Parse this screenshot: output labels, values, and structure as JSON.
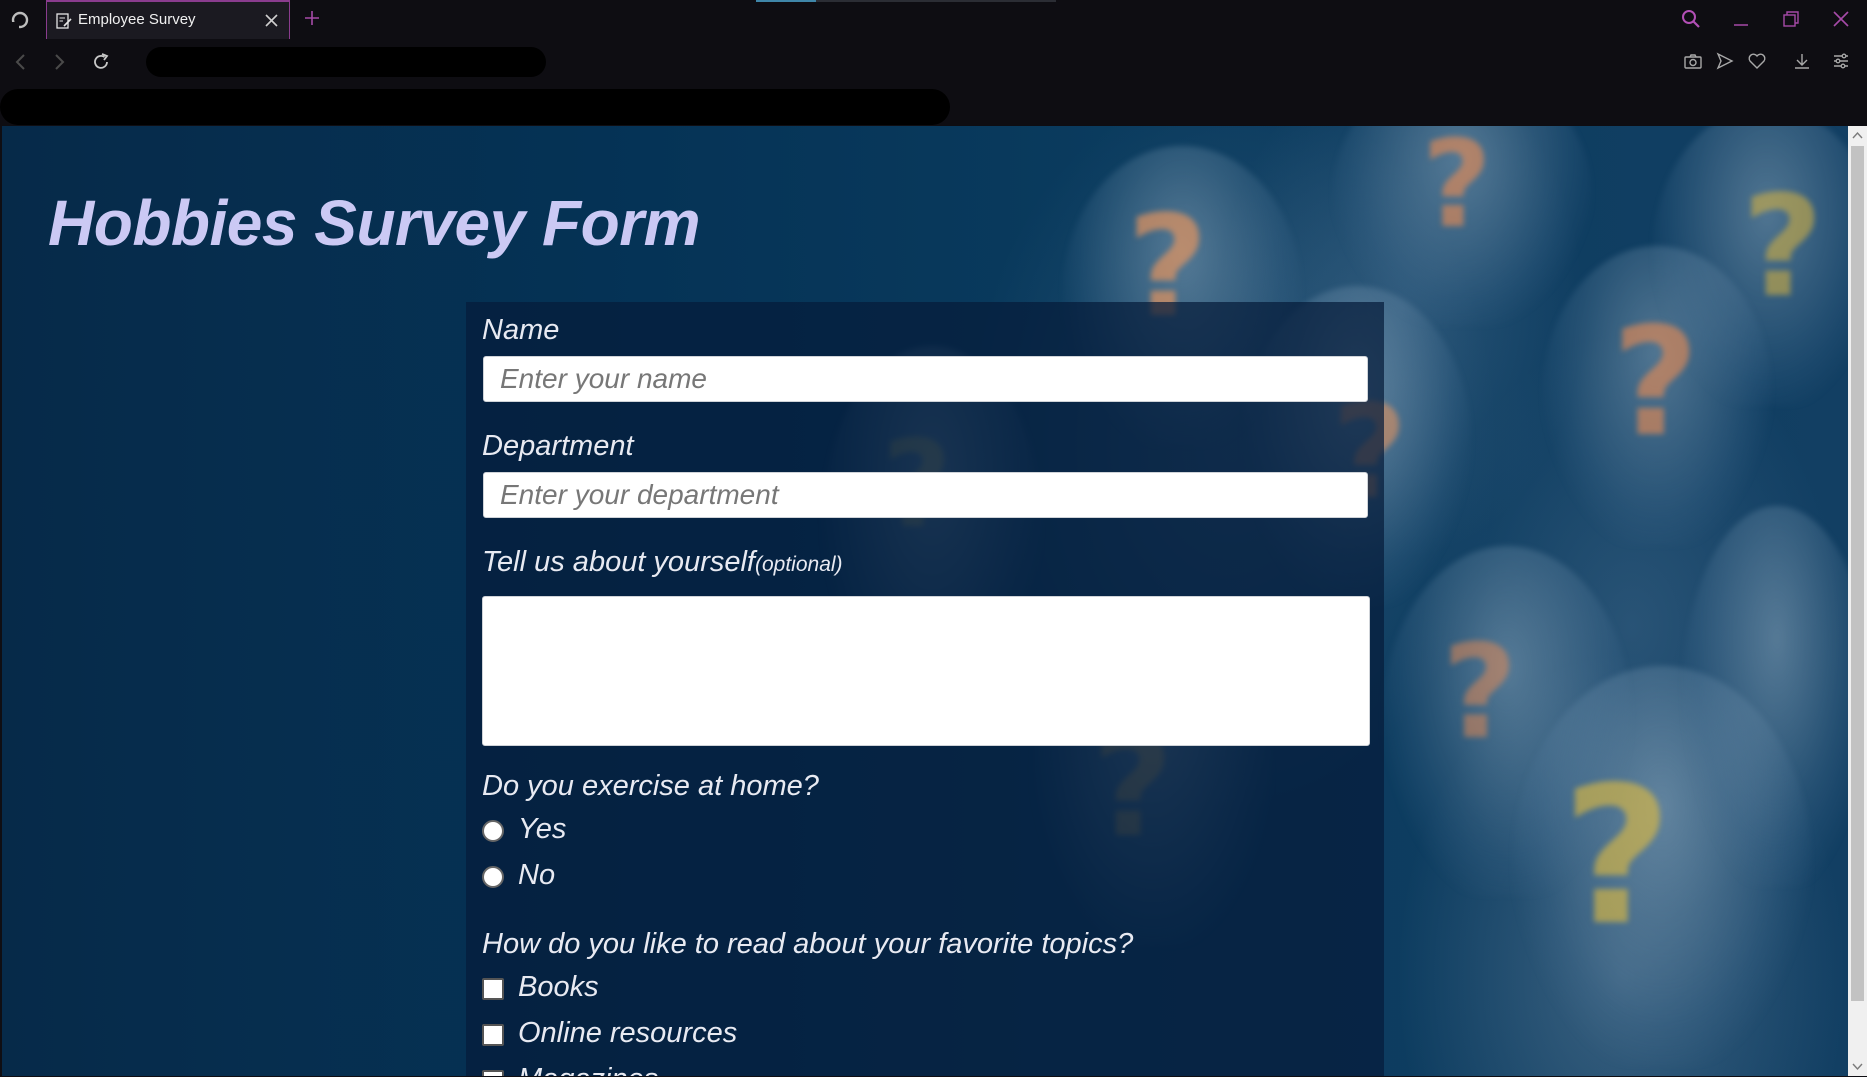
{
  "browser": {
    "tab_title": "Employee Survey",
    "icons": {
      "app": "opera-logo-icon",
      "tab": "edit-document-icon",
      "close_tab": "close-icon",
      "new_tab": "plus-icon",
      "search": "search-icon",
      "minimize": "minimize-icon",
      "restore": "restore-icon",
      "close_window": "close-icon",
      "back": "back-arrow-icon",
      "forward": "forward-arrow-icon",
      "reload": "reload-icon",
      "snapshot": "camera-icon",
      "send": "send-icon",
      "favorite": "heart-icon",
      "download": "download-icon",
      "easy_setup": "settings-sliders-icon"
    },
    "accent_color": "#a64aa8"
  },
  "page": {
    "title": "Hobbies Survey Form",
    "title_color": "#cbc9f4"
  },
  "form": {
    "name": {
      "label": "Name",
      "placeholder": "Enter your name",
      "value": ""
    },
    "department": {
      "label": "Department",
      "placeholder": "Enter your department",
      "value": ""
    },
    "about": {
      "label": "Tell us about yourself",
      "optional_note": "(optional)",
      "value": ""
    },
    "exercise": {
      "question": "Do you exercise at home?",
      "options": [
        "Yes",
        "No"
      ]
    },
    "reading": {
      "question": "How do you like to read about your favorite topics?",
      "options": [
        "Books",
        "Online resources",
        "Magazines"
      ]
    }
  }
}
